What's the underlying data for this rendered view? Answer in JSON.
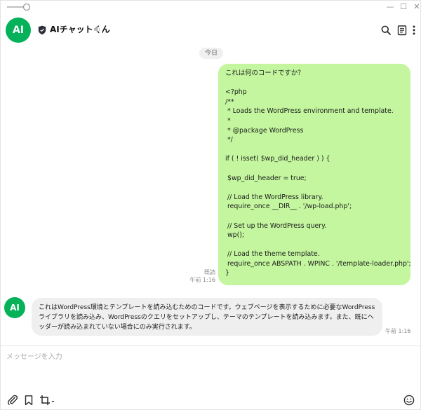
{
  "window": {
    "minimize_glyph": "—",
    "maximize_glyph": "☐",
    "close_glyph": "✕"
  },
  "header": {
    "avatar_text": "AI",
    "chat_name": "AIチャットくん",
    "icons": [
      "shield-icon",
      "mute-icon",
      "search-icon",
      "note-icon",
      "more-icon"
    ]
  },
  "date_separator": "今日",
  "messages": {
    "outgoing": {
      "lines": [
        "これは何のコードですか？",
        "",
        "<?php",
        "/**",
        " * Loads the WordPress environment and template.",
        " *",
        " * @package WordPress",
        " */",
        "",
        "if ( ! isset( $wp_did_header ) ) {",
        "",
        " $wp_did_header = true;",
        "",
        " // Load the WordPress library.",
        " require_once __DIR__ . '/wp-load.php';",
        "",
        " // Set up the WordPress query.",
        " wp();",
        "",
        " // Load the theme template.",
        " require_once ABSPATH . WPINC . '/template-loader.php';",
        "}"
      ],
      "read_status": "既読",
      "time": "午前 1:16"
    },
    "incoming": {
      "avatar_text": "AI",
      "text": "これはWordPress環境とテンプレートを読み込むためのコードです。ウェブページを表示するために必要なWordPressライブラリを読み込み、WordPressのクエリをセットアップし、テーマのテンプレートを読み込みます。また、既にヘッダーが読み込まれていない場合にのみ実行されます。",
      "time": "午前 1:16"
    }
  },
  "composer": {
    "placeholder": "メッセージを入力",
    "value": ""
  },
  "toolbar": {
    "icons": [
      "paperclip-icon",
      "bookmark-icon",
      "crop-icon",
      "emoji-icon"
    ]
  },
  "colors": {
    "accent_green": "#05b25a",
    "outgoing_bubble": "#c3f69e",
    "incoming_bubble": "#efefef"
  }
}
